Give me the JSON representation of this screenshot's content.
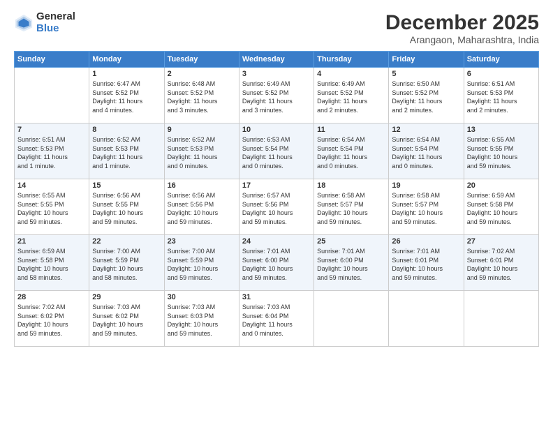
{
  "logo": {
    "general": "General",
    "blue": "Blue"
  },
  "title": "December 2025",
  "subtitle": "Arangaon, Maharashtra, India",
  "headers": [
    "Sunday",
    "Monday",
    "Tuesday",
    "Wednesday",
    "Thursday",
    "Friday",
    "Saturday"
  ],
  "weeks": [
    [
      {
        "day": "",
        "lines": []
      },
      {
        "day": "1",
        "lines": [
          "Sunrise: 6:47 AM",
          "Sunset: 5:52 PM",
          "Daylight: 11 hours",
          "and 4 minutes."
        ]
      },
      {
        "day": "2",
        "lines": [
          "Sunrise: 6:48 AM",
          "Sunset: 5:52 PM",
          "Daylight: 11 hours",
          "and 3 minutes."
        ]
      },
      {
        "day": "3",
        "lines": [
          "Sunrise: 6:49 AM",
          "Sunset: 5:52 PM",
          "Daylight: 11 hours",
          "and 3 minutes."
        ]
      },
      {
        "day": "4",
        "lines": [
          "Sunrise: 6:49 AM",
          "Sunset: 5:52 PM",
          "Daylight: 11 hours",
          "and 2 minutes."
        ]
      },
      {
        "day": "5",
        "lines": [
          "Sunrise: 6:50 AM",
          "Sunset: 5:52 PM",
          "Daylight: 11 hours",
          "and 2 minutes."
        ]
      },
      {
        "day": "6",
        "lines": [
          "Sunrise: 6:51 AM",
          "Sunset: 5:53 PM",
          "Daylight: 11 hours",
          "and 2 minutes."
        ]
      }
    ],
    [
      {
        "day": "7",
        "lines": [
          "Sunrise: 6:51 AM",
          "Sunset: 5:53 PM",
          "Daylight: 11 hours",
          "and 1 minute."
        ]
      },
      {
        "day": "8",
        "lines": [
          "Sunrise: 6:52 AM",
          "Sunset: 5:53 PM",
          "Daylight: 11 hours",
          "and 1 minute."
        ]
      },
      {
        "day": "9",
        "lines": [
          "Sunrise: 6:52 AM",
          "Sunset: 5:53 PM",
          "Daylight: 11 hours",
          "and 0 minutes."
        ]
      },
      {
        "day": "10",
        "lines": [
          "Sunrise: 6:53 AM",
          "Sunset: 5:54 PM",
          "Daylight: 11 hours",
          "and 0 minutes."
        ]
      },
      {
        "day": "11",
        "lines": [
          "Sunrise: 6:54 AM",
          "Sunset: 5:54 PM",
          "Daylight: 11 hours",
          "and 0 minutes."
        ]
      },
      {
        "day": "12",
        "lines": [
          "Sunrise: 6:54 AM",
          "Sunset: 5:54 PM",
          "Daylight: 11 hours",
          "and 0 minutes."
        ]
      },
      {
        "day": "13",
        "lines": [
          "Sunrise: 6:55 AM",
          "Sunset: 5:55 PM",
          "Daylight: 10 hours",
          "and 59 minutes."
        ]
      }
    ],
    [
      {
        "day": "14",
        "lines": [
          "Sunrise: 6:55 AM",
          "Sunset: 5:55 PM",
          "Daylight: 10 hours",
          "and 59 minutes."
        ]
      },
      {
        "day": "15",
        "lines": [
          "Sunrise: 6:56 AM",
          "Sunset: 5:55 PM",
          "Daylight: 10 hours",
          "and 59 minutes."
        ]
      },
      {
        "day": "16",
        "lines": [
          "Sunrise: 6:56 AM",
          "Sunset: 5:56 PM",
          "Daylight: 10 hours",
          "and 59 minutes."
        ]
      },
      {
        "day": "17",
        "lines": [
          "Sunrise: 6:57 AM",
          "Sunset: 5:56 PM",
          "Daylight: 10 hours",
          "and 59 minutes."
        ]
      },
      {
        "day": "18",
        "lines": [
          "Sunrise: 6:58 AM",
          "Sunset: 5:57 PM",
          "Daylight: 10 hours",
          "and 59 minutes."
        ]
      },
      {
        "day": "19",
        "lines": [
          "Sunrise: 6:58 AM",
          "Sunset: 5:57 PM",
          "Daylight: 10 hours",
          "and 59 minutes."
        ]
      },
      {
        "day": "20",
        "lines": [
          "Sunrise: 6:59 AM",
          "Sunset: 5:58 PM",
          "Daylight: 10 hours",
          "and 59 minutes."
        ]
      }
    ],
    [
      {
        "day": "21",
        "lines": [
          "Sunrise: 6:59 AM",
          "Sunset: 5:58 PM",
          "Daylight: 10 hours",
          "and 58 minutes."
        ]
      },
      {
        "day": "22",
        "lines": [
          "Sunrise: 7:00 AM",
          "Sunset: 5:59 PM",
          "Daylight: 10 hours",
          "and 58 minutes."
        ]
      },
      {
        "day": "23",
        "lines": [
          "Sunrise: 7:00 AM",
          "Sunset: 5:59 PM",
          "Daylight: 10 hours",
          "and 59 minutes."
        ]
      },
      {
        "day": "24",
        "lines": [
          "Sunrise: 7:01 AM",
          "Sunset: 6:00 PM",
          "Daylight: 10 hours",
          "and 59 minutes."
        ]
      },
      {
        "day": "25",
        "lines": [
          "Sunrise: 7:01 AM",
          "Sunset: 6:00 PM",
          "Daylight: 10 hours",
          "and 59 minutes."
        ]
      },
      {
        "day": "26",
        "lines": [
          "Sunrise: 7:01 AM",
          "Sunset: 6:01 PM",
          "Daylight: 10 hours",
          "and 59 minutes."
        ]
      },
      {
        "day": "27",
        "lines": [
          "Sunrise: 7:02 AM",
          "Sunset: 6:01 PM",
          "Daylight: 10 hours",
          "and 59 minutes."
        ]
      }
    ],
    [
      {
        "day": "28",
        "lines": [
          "Sunrise: 7:02 AM",
          "Sunset: 6:02 PM",
          "Daylight: 10 hours",
          "and 59 minutes."
        ]
      },
      {
        "day": "29",
        "lines": [
          "Sunrise: 7:03 AM",
          "Sunset: 6:02 PM",
          "Daylight: 10 hours",
          "and 59 minutes."
        ]
      },
      {
        "day": "30",
        "lines": [
          "Sunrise: 7:03 AM",
          "Sunset: 6:03 PM",
          "Daylight: 10 hours",
          "and 59 minutes."
        ]
      },
      {
        "day": "31",
        "lines": [
          "Sunrise: 7:03 AM",
          "Sunset: 6:04 PM",
          "Daylight: 11 hours",
          "and 0 minutes."
        ]
      },
      {
        "day": "",
        "lines": []
      },
      {
        "day": "",
        "lines": []
      },
      {
        "day": "",
        "lines": []
      }
    ]
  ]
}
